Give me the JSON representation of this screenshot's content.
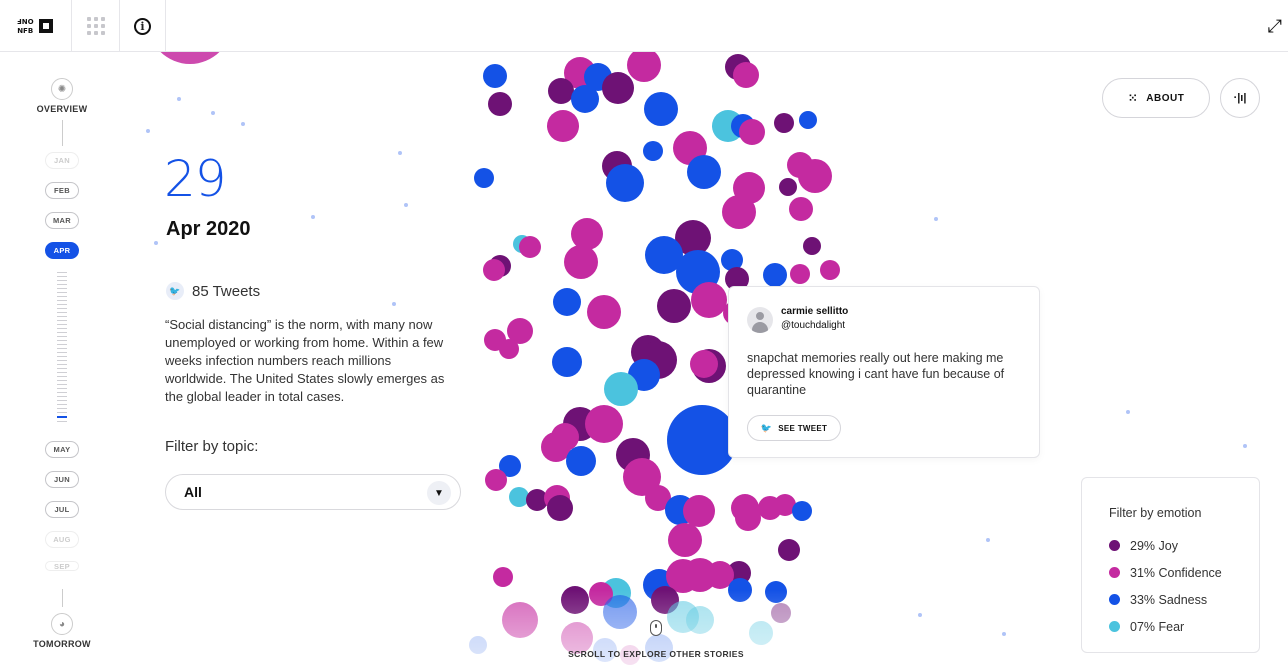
{
  "topbar": {
    "logo_text_1": "ONF",
    "logo_text_2": "NFB",
    "info_glyph": "i",
    "expand_glyph": "⤢"
  },
  "timeline": {
    "overview_label": "OVERVIEW",
    "months": [
      {
        "label": "JAN",
        "state": "faded"
      },
      {
        "label": "FEB",
        "state": "normal"
      },
      {
        "label": "MAR",
        "state": "normal"
      },
      {
        "label": "APR",
        "state": "active"
      },
      {
        "label": "MAY",
        "state": "normal"
      },
      {
        "label": "JUN",
        "state": "normal"
      },
      {
        "label": "JUL",
        "state": "normal"
      },
      {
        "label": "AUG",
        "state": "faded"
      },
      {
        "label": "SEP",
        "state": "faded"
      }
    ],
    "tomorrow_label": "TOMORROW"
  },
  "story": {
    "day": "29",
    "month_year": "Apr 2020",
    "tweet_count": "85 Tweets",
    "description": "“Social distancing” is the norm, with many now unemployed or working from home. Within a few weeks infection numbers reach millions worldwide. The United States slowly emerges as the global leader in total cases.",
    "filter_topic_label": "Filter by topic:",
    "filter_topic_value": "All"
  },
  "buttons": {
    "about_label": "ABOUT"
  },
  "tweet_card": {
    "name": "carmie sellitto",
    "handle": "@touchdalight",
    "text": "snapchat memories really out here making me depressed knowing i cant have fun because of quarantine",
    "see_label": "SEE TWEET"
  },
  "emotion_filter": {
    "title": "Filter by emotion",
    "items": [
      {
        "label": "29% Joy",
        "color": "#6e1275"
      },
      {
        "label": "31% Confidence",
        "color": "#c42aa0"
      },
      {
        "label": "33% Sadness",
        "color": "#1452e6"
      },
      {
        "label": "07% Fear",
        "color": "#4bc3de"
      }
    ]
  },
  "scroll_label": "SCROLL TO EXPLORE OTHER STORIES",
  "colors": {
    "joy": "#6e1275",
    "confidence": "#c42aa0",
    "sadness": "#1452e6",
    "fear": "#4bc3de",
    "accent": "#1452e6"
  }
}
